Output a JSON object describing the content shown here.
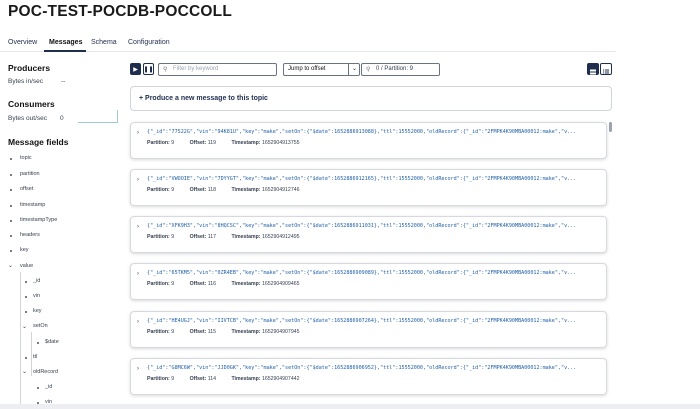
{
  "title": "POC-TEST-POCDB-POCCOLL",
  "tabs": [
    "Overview",
    "Messages",
    "Schema",
    "Configuration"
  ],
  "producers": {
    "heading": "Producers",
    "label": "Bytes in/sec",
    "value": "--"
  },
  "consumers": {
    "heading": "Consumers",
    "label": "Bytes out/sec",
    "value": "0"
  },
  "message_fields": {
    "heading": "Message fields",
    "items": [
      "topic",
      "partition",
      "offset",
      "timestamp",
      "timestampType",
      "headers",
      "key",
      "value",
      "_id",
      "vin",
      "key",
      "setOn",
      "$date",
      "ttl",
      "oldRecord",
      "_id",
      "vin"
    ]
  },
  "toolbar": {
    "search_placeholder": "Filter by keyword",
    "jump_label": "Jump to offset",
    "offset_value": "0 / Partition: 9"
  },
  "produce_label": "+ Produce a new message to this topic",
  "meta_labels": {
    "partition": "Partition:",
    "offset": "Offset:",
    "timestamp": "Timestamp:"
  },
  "messages": [
    {
      "json": "{\"_id\":\"77522G\",\"vin\":\"94K81U\",\"key\":\"make\",\"setOn\":{\"$date\":1652886913088},\"ttl\":15552000,\"oldRecord\":{\"_id\":\"2FMPK4K90MBA00012:make\",\"v...",
      "partition": "9",
      "offset": "119",
      "timestamp": "1652904913755"
    },
    {
      "json": "{\"_id\":\"VWOOIE\",\"vin\":\"7DYYGT\",\"key\":\"make\",\"setOn\":{\"$date\":1652886912165},\"ttl\":15552000,\"oldRecord\":{\"_id\":\"2FMPK4K90MBA00012:make\",\"v...",
      "partition": "9",
      "offset": "118",
      "timestamp": "1652904912746"
    },
    {
      "json": "{\"_id\":\"XFK9H3\",\"vin\":\"8HQCSC\",\"key\":\"make\",\"setOn\":{\"$date\":1652886911031},\"ttl\":15552000,\"oldRecord\":{\"_id\":\"2FMPK4K90MBA00012:make\",\"v...",
      "partition": "9",
      "offset": "117",
      "timestamp": "1652904912495"
    },
    {
      "json": "{\"_id\":\"65TKM5\",\"vin\":\"0ZR4EB\",\"key\":\"make\",\"setOn\":{\"$date\":1652886909089},\"ttl\":15552000,\"oldRecord\":{\"_id\":\"2FMPK4K90MBA00012:make\",\"v...",
      "partition": "9",
      "offset": "116",
      "timestamp": "1652904909465"
    },
    {
      "json": "{\"_id\":\"HE4UGJ\",\"vin\":\"IIVTCB\",\"key\":\"make\",\"setOn\":{\"$date\":1652886907264},\"ttl\":15552000,\"oldRecord\":{\"_id\":\"2FMPK4K90MBA00012:make\",\"v...",
      "partition": "9",
      "offset": "115",
      "timestamp": "1652904907945"
    },
    {
      "json": "{\"_id\":\"G8MC6W\",\"vin\":\"JJD0GK\",\"key\":\"make\",\"setOn\":{\"$date\":1652886906952},\"ttl\":15552000,\"oldRecord\":{\"_id\":\"2FMPK4K90MBA00012:make\",\"v...",
      "partition": "9",
      "offset": "114",
      "timestamp": "1652904907442"
    }
  ],
  "colors": {
    "accent": "#1f2d4e",
    "json_text": "#1f5fa8",
    "border": "#d6d9de"
  },
  "icons": [
    "play-icon",
    "pause-icon",
    "search-icon",
    "chevron-down-icon",
    "chevron-right-icon",
    "plus-icon",
    "card-view-icon",
    "list-view-icon"
  ]
}
